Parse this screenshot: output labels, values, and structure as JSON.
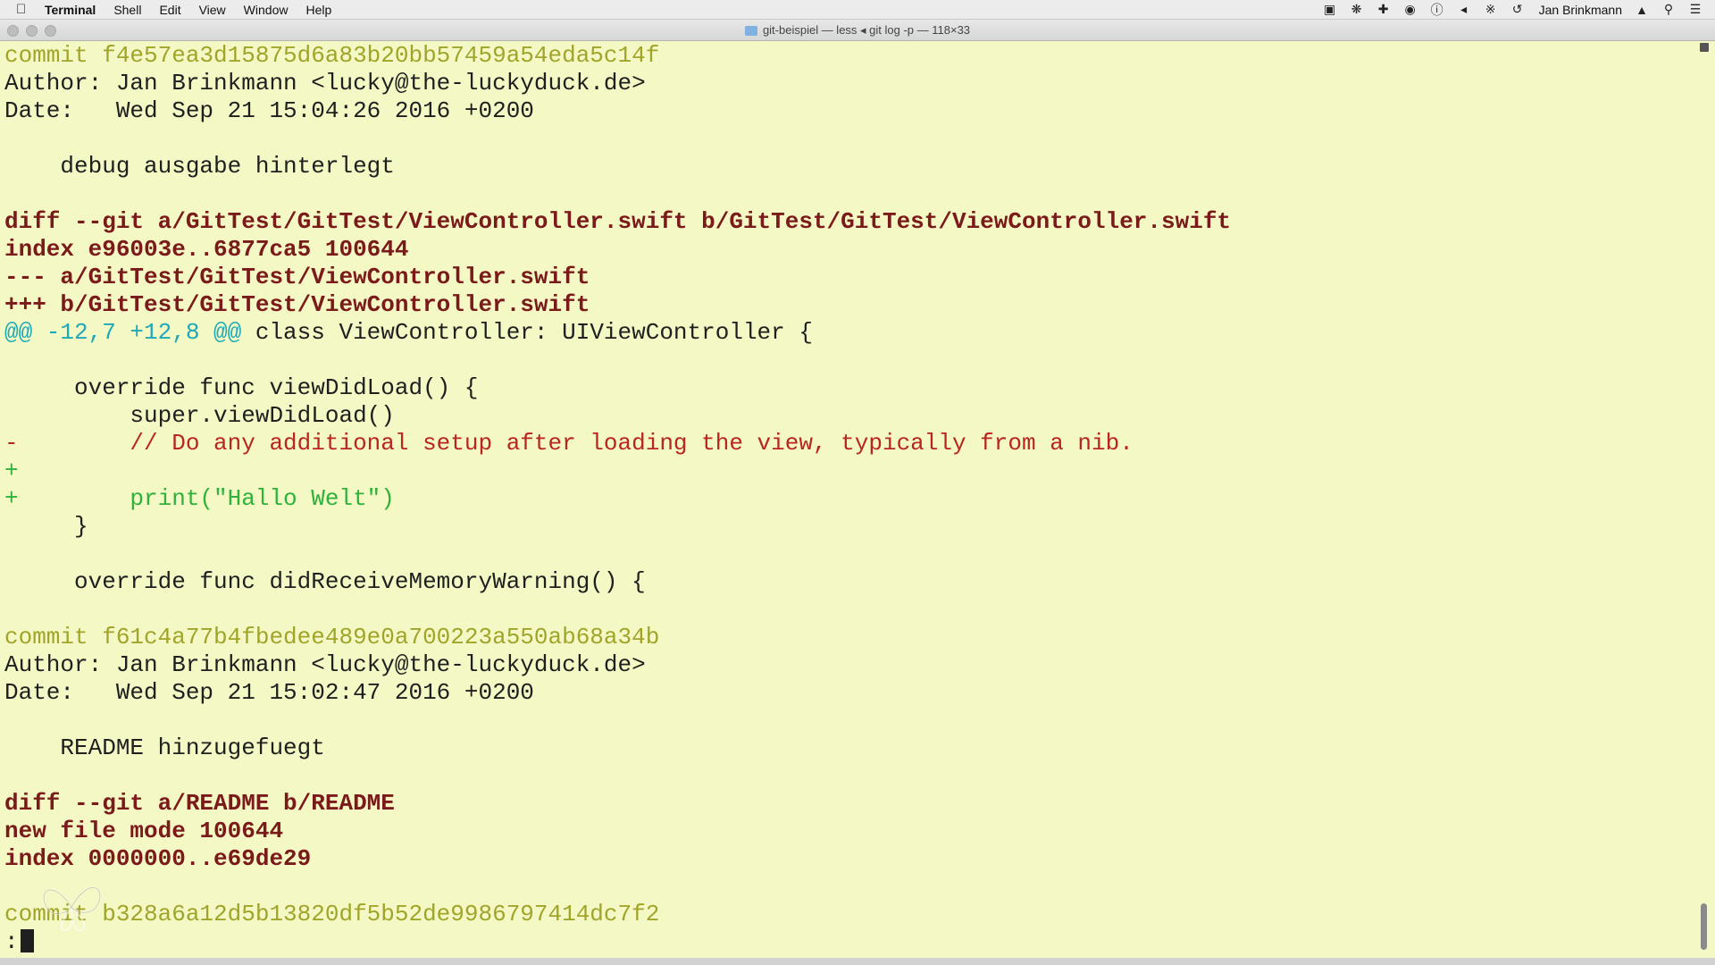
{
  "menubar": {
    "app": "Terminal",
    "items": [
      "Shell",
      "Edit",
      "View",
      "Window",
      "Help"
    ],
    "user": "Jan Brinkmann",
    "status_icons": [
      "camera-icon",
      "dropbox-icon",
      "puzzle-icon",
      "leaf-icon",
      "info-icon",
      "volume-icon",
      "bluetooth-icon",
      "time-machine-icon",
      "wifi-icon",
      "search-icon",
      "list-icon"
    ]
  },
  "window": {
    "title": "git-beispiel — less ◂ git log -p — 118×33"
  },
  "terminal": {
    "lines": [
      {
        "cls": "commit",
        "text": "commit f4e57ea3d15875d6a83b20bb57459a54eda5c14f"
      },
      {
        "cls": "meta",
        "text": "Author: Jan Brinkmann <lucky@the-luckyduck.de>"
      },
      {
        "cls": "meta",
        "text": "Date:   Wed Sep 21 15:04:26 2016 +0200"
      },
      {
        "cls": "meta",
        "text": ""
      },
      {
        "cls": "meta",
        "text": "    debug ausgabe hinterlegt"
      },
      {
        "cls": "meta",
        "text": ""
      },
      {
        "cls": "diffhdr",
        "text": "diff --git a/GitTest/GitTest/ViewController.swift b/GitTest/GitTest/ViewController.swift"
      },
      {
        "cls": "diffhdr",
        "text": "index e96003e..6877ca5 100644"
      },
      {
        "cls": "diffhdr",
        "text": "--- a/GitTest/GitTest/ViewController.swift"
      },
      {
        "cls": "diffhdr",
        "text": "+++ b/GitTest/GitTest/ViewController.swift"
      },
      {
        "cls": "hunk",
        "text": "@@ -12,7 +12,8 @@",
        "rest": " class ViewController: UIViewController {"
      },
      {
        "cls": "ctx",
        "text": ""
      },
      {
        "cls": "ctx",
        "text": "     override func viewDidLoad() {"
      },
      {
        "cls": "ctx",
        "text": "         super.viewDidLoad()"
      },
      {
        "cls": "del",
        "text": "-        // Do any additional setup after loading the view, typically from a nib."
      },
      {
        "cls": "add",
        "text": "+"
      },
      {
        "cls": "add",
        "text": "+        print(\"Hallo Welt\")"
      },
      {
        "cls": "ctx",
        "text": "     }"
      },
      {
        "cls": "ctx",
        "text": ""
      },
      {
        "cls": "ctx",
        "text": "     override func didReceiveMemoryWarning() {"
      },
      {
        "cls": "ctx",
        "text": ""
      },
      {
        "cls": "commit",
        "text": "commit f61c4a77b4fbedee489e0a700223a550ab68a34b"
      },
      {
        "cls": "meta",
        "text": "Author: Jan Brinkmann <lucky@the-luckyduck.de>"
      },
      {
        "cls": "meta",
        "text": "Date:   Wed Sep 21 15:02:47 2016 +0200"
      },
      {
        "cls": "meta",
        "text": ""
      },
      {
        "cls": "meta",
        "text": "    README hinzugefuegt"
      },
      {
        "cls": "meta",
        "text": ""
      },
      {
        "cls": "diffhdr",
        "text": "diff --git a/README b/README"
      },
      {
        "cls": "diffhdr",
        "text": "new file mode 100644"
      },
      {
        "cls": "diffhdr",
        "text": "index 0000000..e69de29"
      },
      {
        "cls": "meta",
        "text": ""
      },
      {
        "cls": "commit",
        "text": "commit b328a6a12d5b13820df5b52de9986797414dc7f2"
      }
    ],
    "prompt": ":"
  },
  "colors": {
    "background": "#f4f8c4",
    "commit": "#a0a52a",
    "diff_header": "#7a1a1a",
    "hunk": "#1da9b8",
    "deleted": "#b8261f",
    "added": "#2fb23a"
  }
}
